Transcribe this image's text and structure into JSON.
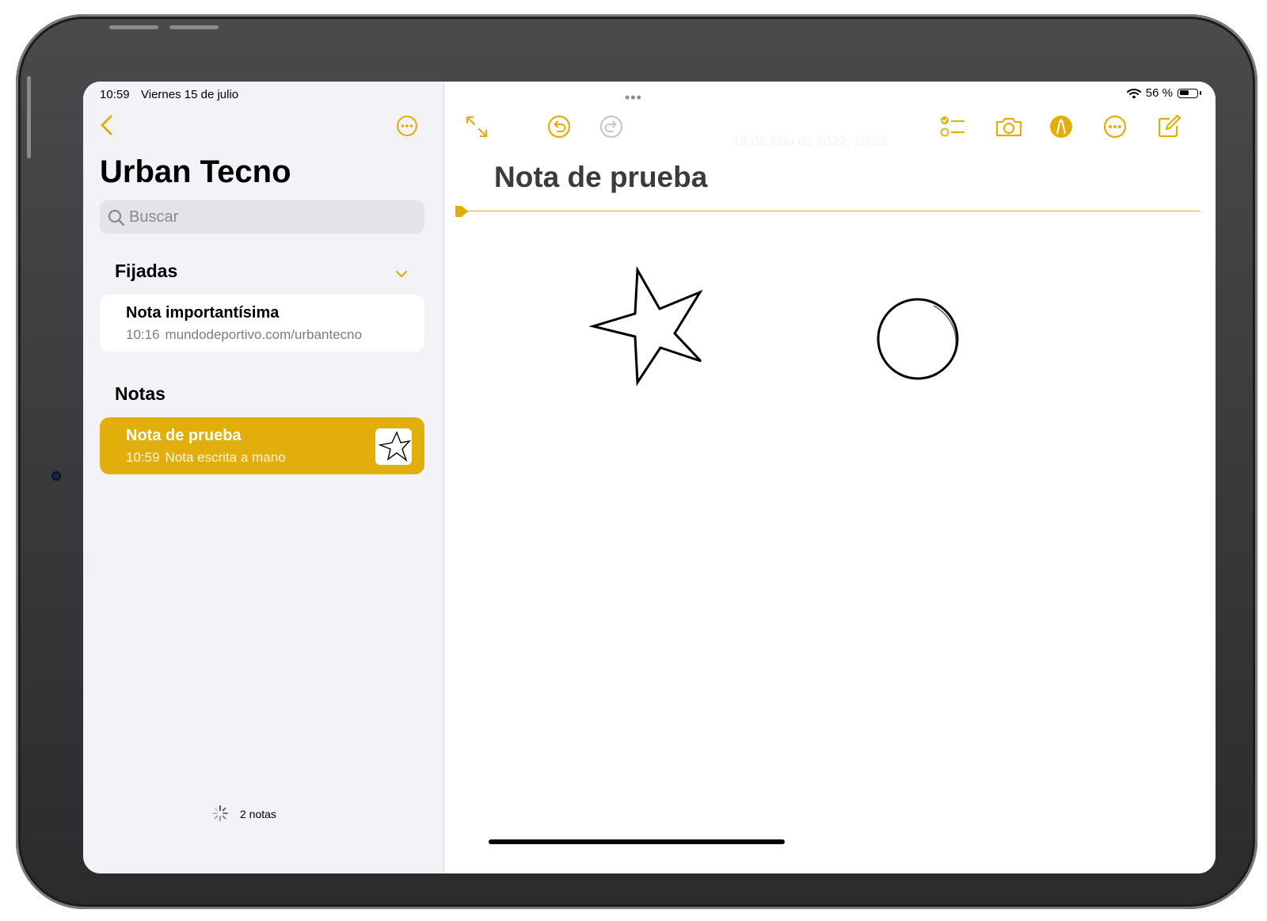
{
  "status": {
    "time": "10:59",
    "date": "Viernes 15 de julio",
    "battery_text": "56 %",
    "battery_level": 0.56
  },
  "sidebar": {
    "folder_title": "Urban Tecno",
    "search_placeholder": "Buscar",
    "pinned_heading": "Fijadas",
    "notes_heading": "Notas",
    "pinned_notes": [
      {
        "title": "Nota importantísima",
        "time": "10:16",
        "preview": "mundodeportivo.com/urbantecno"
      }
    ],
    "notes": [
      {
        "title": "Nota de prueba",
        "time": "10:59",
        "preview": "Nota escrita a mano"
      }
    ],
    "footer_count": "2 notas"
  },
  "toolbar": {
    "icons": [
      "expand-icon",
      "undo-icon",
      "redo-icon",
      "checklist-icon",
      "camera-icon",
      "markup-icon",
      "more-icon",
      "compose-icon"
    ]
  },
  "note": {
    "timestamp": "15 de julio de 2022, 10:59",
    "title": "Nota de prueba"
  },
  "colors": {
    "accent": "#e2ae0c",
    "sidebar_bg": "#f2f2f7",
    "selected_note_bg": "#e2ae0c"
  }
}
